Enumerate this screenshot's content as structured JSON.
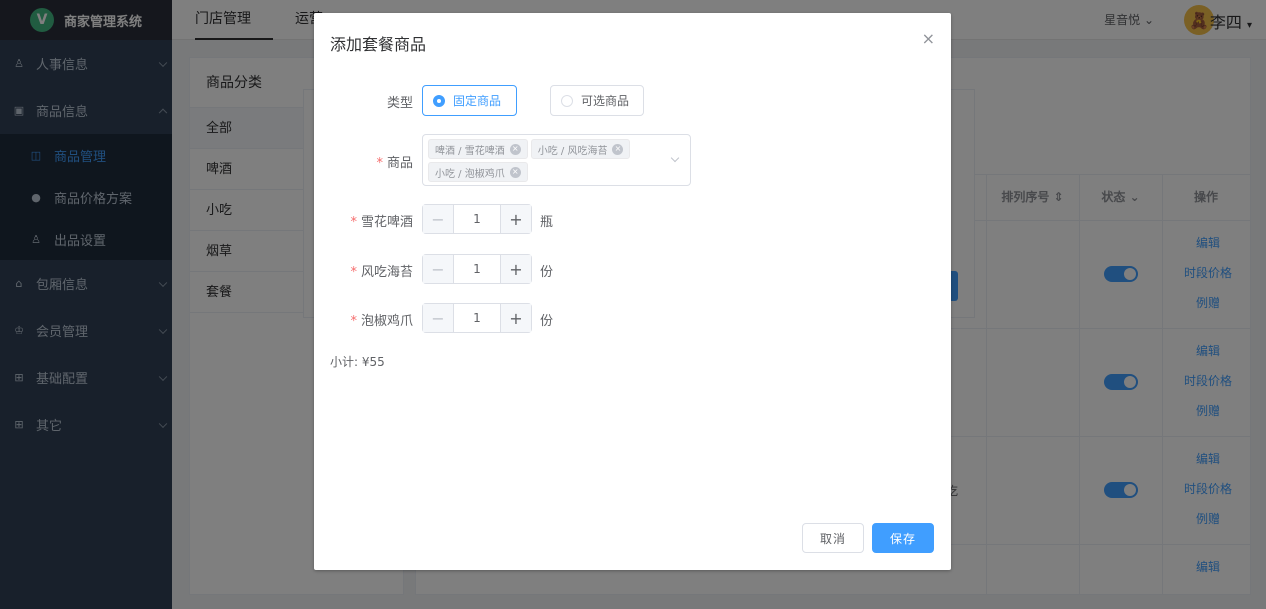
{
  "app": {
    "logo_letter": "V",
    "title": "商家管理系统"
  },
  "sidebar": {
    "items": [
      {
        "label": "人事信息",
        "icon": "user-icon"
      },
      {
        "label": "商品信息",
        "icon": "goods-icon",
        "expanded": true
      },
      {
        "label": "包厢信息",
        "icon": "home-icon"
      },
      {
        "label": "会员管理",
        "icon": "member-icon"
      },
      {
        "label": "基础配置",
        "icon": "grid-icon"
      },
      {
        "label": "其它",
        "icon": "grid-icon"
      }
    ],
    "sub_items": [
      {
        "label": "商品管理",
        "active": true
      },
      {
        "label": "商品价格方案"
      },
      {
        "label": "出品设置"
      }
    ]
  },
  "topbar": {
    "tabs": [
      "门店管理",
      "运营"
    ],
    "store": "星音悦",
    "user": "李四"
  },
  "background": {
    "category_title": "商品分类",
    "categories": [
      "全部",
      "啤酒",
      "小吃",
      "烟草",
      "套餐"
    ],
    "columns": {
      "sort": "排列序号",
      "status": "状态",
      "actions": "操作"
    },
    "row_actions": [
      "编辑",
      "时段价格",
      "例赠"
    ],
    "last_action": "编辑",
    "partial_text": "吃"
  },
  "dialog": {
    "title": "添加套餐商品",
    "close": "×",
    "type_label": "类型",
    "type_options": [
      "固定商品",
      "可选商品"
    ],
    "goods_label": "商品",
    "selected_goods": [
      "啤酒 / 雪花啤酒",
      "小吃 / 风吃海苔",
      "小吃 / 泡椒鸡爪"
    ],
    "items": [
      {
        "label": "雪花啤酒",
        "qty": "1",
        "unit": "瓶"
      },
      {
        "label": "风吃海苔",
        "qty": "1",
        "unit": "份"
      },
      {
        "label": "泡椒鸡爪",
        "qty": "1",
        "unit": "份"
      }
    ],
    "subtotal_label": "小计:",
    "subtotal_value": "¥55",
    "cancel": "取消",
    "save": "保存"
  }
}
